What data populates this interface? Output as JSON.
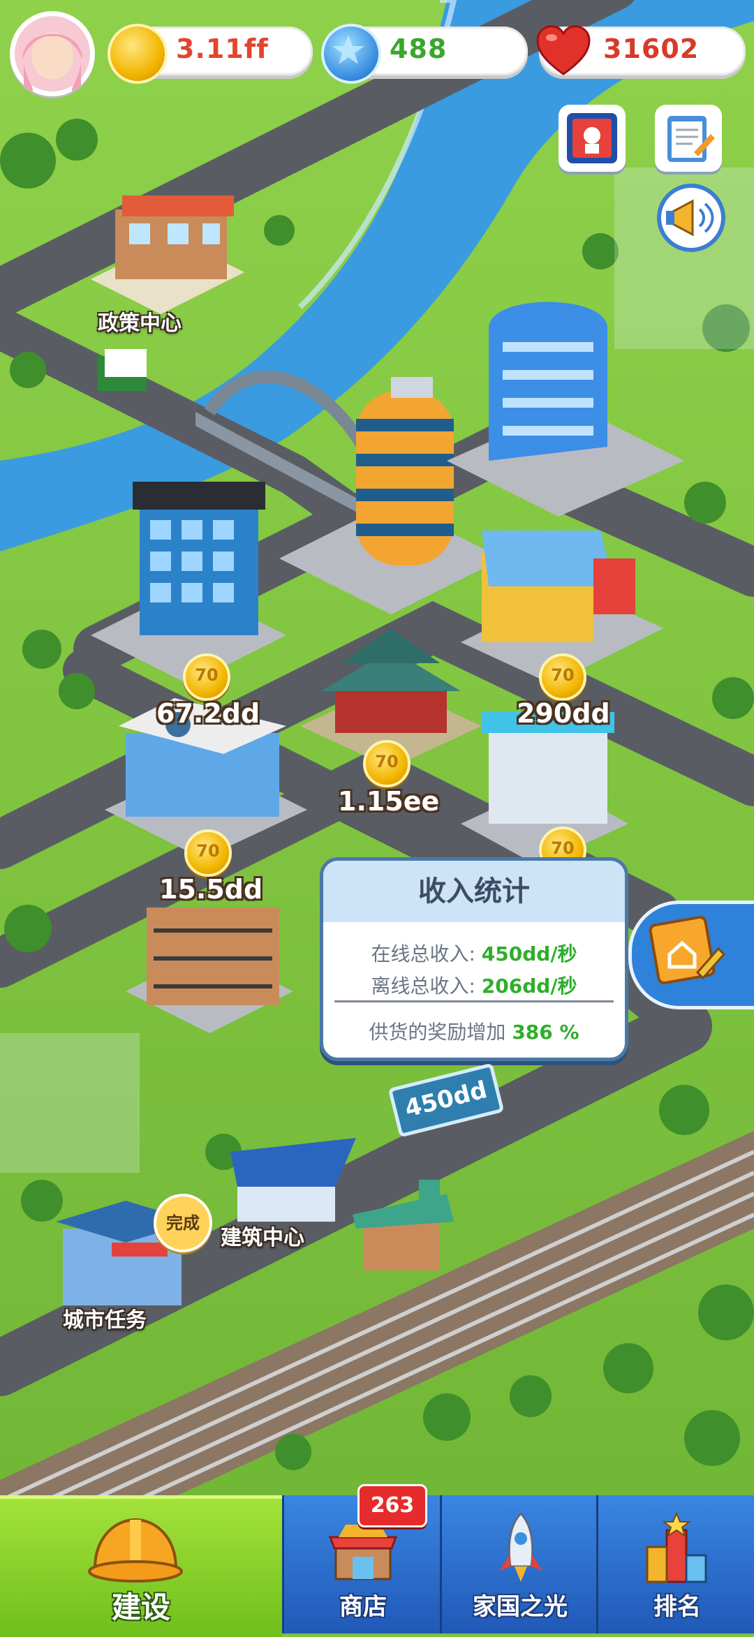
{
  "player": {
    "avatar_icon": "player-avatar-icon"
  },
  "resources": {
    "coins": {
      "value": "3.11ff",
      "icon": "gold-coin-icon",
      "color": "#e2452d"
    },
    "stars": {
      "value": "488",
      "icon": "blue-star-icon",
      "color": "#3aa62d"
    },
    "hearts": {
      "value": "31602",
      "icon": "heart-icon",
      "color": "#d83a2a"
    }
  },
  "side_buttons": [
    {
      "icon": "event-poster-icon"
    },
    {
      "icon": "clipboard-task-icon"
    },
    {
      "icon": "announcement-megaphone-icon"
    }
  ],
  "map_labels": {
    "policy_center": "政策中心",
    "build_center": "建筑中心",
    "city_task": "城市任务",
    "done_badge": "完成"
  },
  "building_income": {
    "office_tower": "67.2dd",
    "gift_shop": "290dd",
    "pagoda": "1.15ee",
    "hospital": "15.5dd"
  },
  "coin_glyph": "70",
  "income_stats": {
    "title": "收入统计",
    "online_label": "在线总收入:",
    "online_value": "450dd/秒",
    "offline_label": "离线总收入:",
    "offline_value": "206dd/秒",
    "supply_label": "供货的奖励增加",
    "supply_value": "386 %"
  },
  "billboard": "450dd",
  "tabs": [
    {
      "label": "建设",
      "icon": "hard-hat-icon",
      "active": true
    },
    {
      "label": "商店",
      "icon": "shop-icon",
      "badge": "263"
    },
    {
      "label": "家国之光",
      "icon": "rocket-icon"
    },
    {
      "label": "排名",
      "icon": "trophy-ranking-icon"
    }
  ],
  "colors": {
    "grass": "#7cc63b",
    "river": "#3b9be0",
    "road": "#595d63",
    "tab_active": "#8ed130",
    "tab_blue": "#2c73d2"
  }
}
